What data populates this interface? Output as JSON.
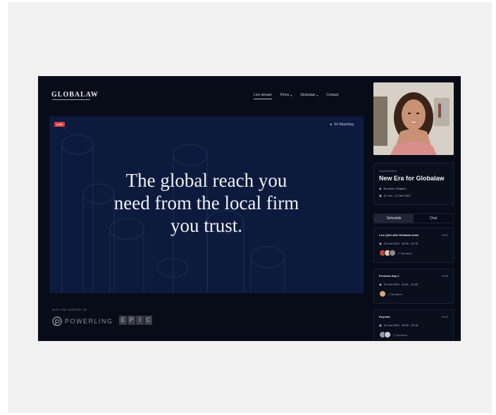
{
  "header": {
    "logo": "GLOBALAW",
    "nav": [
      {
        "label": "Live stream",
        "active": true,
        "dropdown": false
      },
      {
        "label": "Firms",
        "active": false,
        "dropdown": true
      },
      {
        "label": "Globalaw",
        "active": false,
        "dropdown": true
      },
      {
        "label": "Contact",
        "active": false,
        "dropdown": false
      }
    ]
  },
  "hero": {
    "badge": "LIVE",
    "watching": "64 Watching",
    "headline": "The global reach you\nneed from the local firm\nyou trust."
  },
  "sponsors": {
    "label": "WITH THE SUPPORT OF",
    "powerling": "POWERLING",
    "epic": [
      "E",
      "P",
      "I",
      "C"
    ]
  },
  "event": {
    "label": "Current Event",
    "title": "New Era for Globalaw",
    "location": "Brussels, Belgium",
    "dates": "22 Jan - 24 Jan 2023"
  },
  "tabs": [
    {
      "label": "Schedule",
      "active": true
    },
    {
      "label": "Chat",
      "active": false
    }
  ],
  "sessions": [
    {
      "title": "Live Q&A with Globalaw team",
      "duration": "2h10",
      "date": "23 Jan 2023",
      "time": "15:30 - 22:15",
      "speakers": "3 Speakers"
    },
    {
      "title": "Preshow Day 2",
      "duration": "0h30",
      "date": "24 Jan 2023",
      "time": "11:30 - 12:00",
      "speakers": "1 Speakers"
    },
    {
      "title": "Keynote",
      "duration": "2h10",
      "date": "24 Jan 2023",
      "time": "16:00 - 20:15",
      "speakers": "2 Speakers"
    }
  ],
  "colors": {
    "accent_live": "#d93a3a",
    "hero_bg": "#0c1a3d",
    "app_bg": "#080c18"
  }
}
